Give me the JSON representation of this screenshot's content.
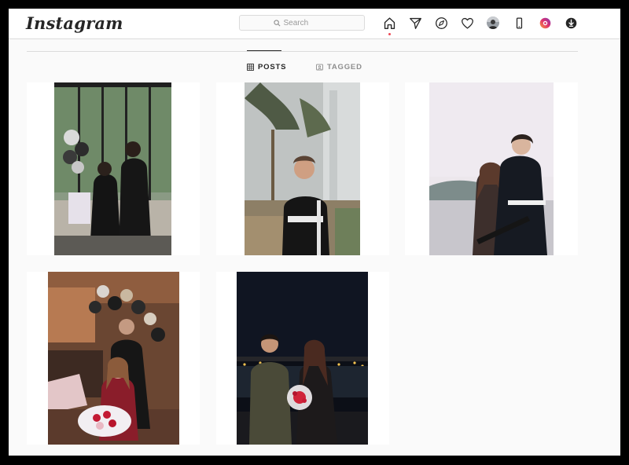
{
  "app": {
    "logo_text": "Instagram"
  },
  "search": {
    "placeholder": "Search"
  },
  "nav": [
    {
      "name": "home-icon",
      "active": true
    },
    {
      "name": "direct-message-icon"
    },
    {
      "name": "explore-compass-icon"
    },
    {
      "name": "activity-heart-icon"
    },
    {
      "name": "profile-avatar"
    },
    {
      "name": "mobile-icon"
    },
    {
      "name": "extension-icon"
    },
    {
      "name": "download-icon"
    }
  ],
  "tabs": [
    {
      "label": "POSTS",
      "icon": "grid-icon",
      "active": true
    },
    {
      "label": "TAGGED",
      "icon": "tagged-icon",
      "active": false
    }
  ],
  "posts": [
    {
      "id": 1,
      "scene": "couple at party venue with balloons and glass windows"
    },
    {
      "id": 2,
      "scene": "young man in black jacket by palm trees and buildings"
    },
    {
      "id": 3,
      "scene": "couple embracing by water at dusk"
    },
    {
      "id": 4,
      "scene": "couple sitting on sofa with balloon arch and flowers"
    },
    {
      "id": 5,
      "scene": "couple at night by harbor with lit bouquet"
    }
  ],
  "colors": {
    "accent_dot": "#ed4956",
    "border": "#dbdbdb",
    "text": "#262626",
    "muted": "#8e8e8e"
  }
}
